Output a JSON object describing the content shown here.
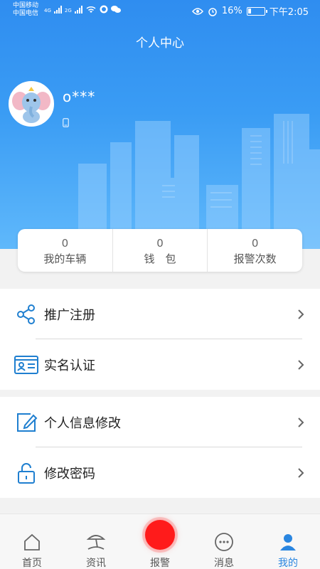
{
  "status_bar": {
    "carrier1": "中国移动",
    "carrier2": "中国电信",
    "net1": "4G",
    "net2": "2G",
    "battery": "16%",
    "time": "下午2:05"
  },
  "header": {
    "title": "个人中心"
  },
  "profile": {
    "username": "o***"
  },
  "stats": [
    {
      "value": "0",
      "label": "我的车辆"
    },
    {
      "value": "0",
      "label": "钱　包"
    },
    {
      "value": "0",
      "label": "报警次数"
    }
  ],
  "menu_group1": [
    {
      "label": "推广注册",
      "icon": "share-icon"
    },
    {
      "label": "实名认证",
      "icon": "id-card-icon"
    }
  ],
  "menu_group2": [
    {
      "label": "个人信息修改",
      "icon": "edit-icon"
    },
    {
      "label": "修改密码",
      "icon": "lock-icon"
    }
  ],
  "tabs": [
    {
      "label": "首页",
      "icon": "home-icon"
    },
    {
      "label": "资讯",
      "icon": "beach-icon"
    },
    {
      "label": "报警",
      "icon": "alarm-button-icon"
    },
    {
      "label": "消息",
      "icon": "message-icon"
    },
    {
      "label": "我的",
      "icon": "user-icon",
      "active": true
    }
  ],
  "colors": {
    "accent": "#2a86e0",
    "alarm": "#ff1b1b",
    "header_top": "#2f8df0"
  }
}
